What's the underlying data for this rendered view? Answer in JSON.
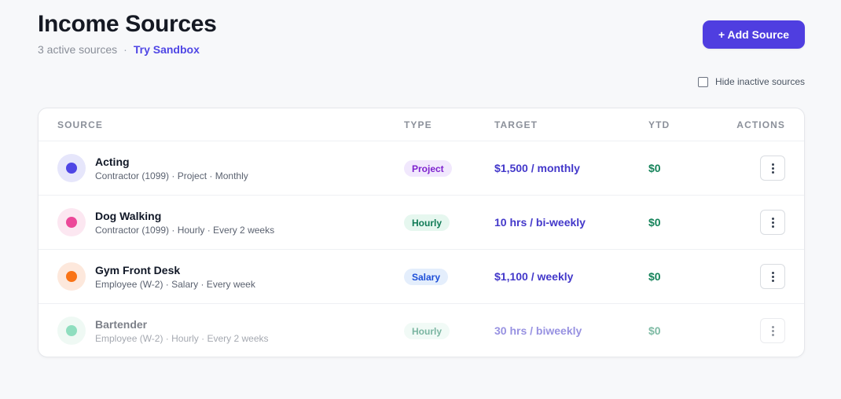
{
  "header": {
    "title": "Income Sources",
    "active_count": "3 active sources",
    "separator": "·",
    "sandbox_link": "Try Sandbox",
    "add_button": "+ Add Source"
  },
  "filter": {
    "hide_inactive_label": "Hide inactive sources",
    "hide_inactive_checked": false
  },
  "table": {
    "columns": [
      "SOURCE",
      "TYPE",
      "TARGET",
      "YTD",
      "ACTIONS"
    ],
    "rows": [
      {
        "name": "Acting",
        "meta": "Contractor (1099) · Project · Monthly",
        "type": "Project",
        "target": "$1,500 / monthly",
        "ytd": "$0",
        "active": true,
        "dot_color": "#4f46e5",
        "avatar_bg": "#e6e6fb",
        "badge_bg": "#f1e8fd",
        "badge_color": "#7e22ce"
      },
      {
        "name": "Dog Walking",
        "meta": "Contractor (1099) · Hourly · Every 2 weeks",
        "type": "Hourly",
        "target": "10 hrs / bi-weekly",
        "ytd": "$0",
        "active": true,
        "dot_color": "#ec4899",
        "avatar_bg": "#fce7f1",
        "badge_bg": "#e6f7ef",
        "badge_color": "#0f7a55"
      },
      {
        "name": "Gym Front Desk",
        "meta": "Employee (W-2) · Salary · Every week",
        "type": "Salary",
        "target": "$1,100 / weekly",
        "ytd": "$0",
        "active": true,
        "dot_color": "#f97316",
        "avatar_bg": "#fde8dc",
        "badge_bg": "#e4eefc",
        "badge_color": "#1d4ed8"
      },
      {
        "name": "Bartender",
        "meta": "Employee (W-2) · Hourly · Every 2 weeks",
        "type": "Hourly",
        "target": "30 hrs / biweekly",
        "ytd": "$0",
        "active": false,
        "dot_color": "#34c48b",
        "avatar_bg": "#e2f5ec",
        "badge_bg": "#e6f7ef",
        "badge_color": "#0f7a55"
      }
    ]
  }
}
